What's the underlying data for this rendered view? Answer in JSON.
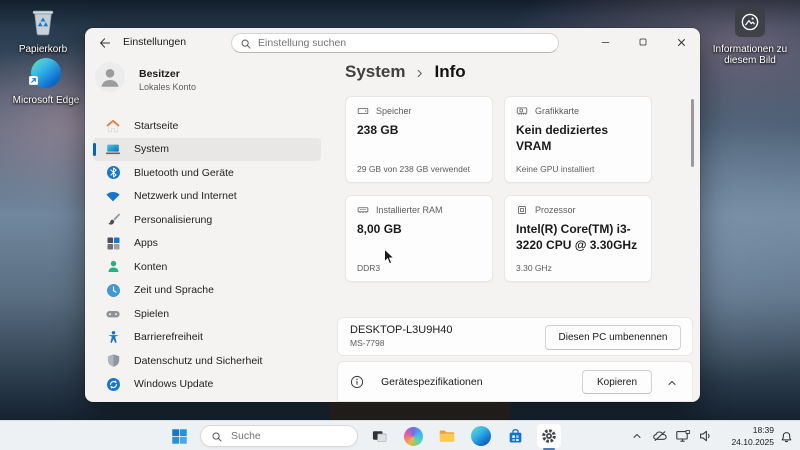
{
  "desktop": {
    "icons": [
      {
        "icon": "recycle-bin-icon",
        "label": "Papierkorb"
      },
      {
        "icon": "edge-logo-icon",
        "label": "Microsoft Edge"
      },
      {
        "icon": "image-info-icon",
        "label": "Informationen zu diesem Bild"
      }
    ]
  },
  "settings_window": {
    "title": "Einstellungen",
    "search": {
      "placeholder": "Einstellung suchen"
    },
    "window_controls": [
      "minimize-icon",
      "maximize-icon",
      "close-icon"
    ],
    "user": {
      "name": "Besitzer",
      "subtitle": "Lokales Konto"
    },
    "nav": [
      {
        "label": "Startseite",
        "icon": "home-icon",
        "selected": false
      },
      {
        "label": "System",
        "icon": "system-icon",
        "selected": true
      },
      {
        "label": "Bluetooth und Geräte",
        "icon": "bluetooth-icon",
        "selected": false
      },
      {
        "label": "Netzwerk und Internet",
        "icon": "network-icon",
        "selected": false
      },
      {
        "label": "Personalisierung",
        "icon": "personalization-icon",
        "selected": false
      },
      {
        "label": "Apps",
        "icon": "apps-icon",
        "selected": false
      },
      {
        "label": "Konten",
        "icon": "accounts-icon",
        "selected": false
      },
      {
        "label": "Zeit und Sprache",
        "icon": "time-language-icon",
        "selected": false
      },
      {
        "label": "Spielen",
        "icon": "gaming-icon",
        "selected": false
      },
      {
        "label": "Barrierefreiheit",
        "icon": "accessibility-icon",
        "selected": false
      },
      {
        "label": "Datenschutz und Sicherheit",
        "icon": "privacy-icon",
        "selected": false
      },
      {
        "label": "Windows Update",
        "icon": "windows-update-icon",
        "selected": false
      }
    ],
    "breadcrumb": {
      "parent": "System",
      "separator": "›",
      "current": "Info"
    },
    "spec_cards": [
      {
        "icon": "storage-icon",
        "title": "Speicher",
        "value": "238 GB",
        "footer": "29 GB von 238 GB verwendet"
      },
      {
        "icon": "gpu-icon",
        "title": "Grafikkarte",
        "value": "Kein dediziertes VRAM",
        "footer": "Keine GPU installiert"
      },
      {
        "icon": "ram-icon",
        "title": "Installierter RAM",
        "value": "8,00 GB",
        "footer": "DDR3"
      },
      {
        "icon": "cpu-icon",
        "title": "Prozessor",
        "value": "Intel(R) Core(TM) i3-3220 CPU @ 3.30GHz",
        "footer": "3.30 GHz"
      }
    ],
    "device": {
      "name": "DESKTOP-L3U9H40",
      "model": "MS-7798",
      "rename_button": "Diesen PC umbenennen"
    },
    "specs_section": {
      "label": "Gerätespezifikationen",
      "copy_button": "Kopieren"
    }
  },
  "taskbar": {
    "search": {
      "placeholder": "Suche"
    },
    "app_icons": [
      "task-view-icon",
      "copilot-icon",
      "explorer-icon",
      "edge-icon",
      "store-icon",
      "settings-gear-icon"
    ],
    "active_app": "settings-gear-icon",
    "tray_icons": [
      "chevron-up-icon",
      "onedrive-cloud-icon",
      "network-monitor-icon",
      "volume-icon"
    ],
    "clock": {
      "time": "18:39",
      "date": "24.10.2025"
    },
    "notification_icon": "bell-icon"
  },
  "colors": {
    "accent": "#0067c0",
    "window_bg": "#f4f3f1",
    "card_bg": "#fdfdfd",
    "taskbar_bg": "#eef1f4"
  }
}
